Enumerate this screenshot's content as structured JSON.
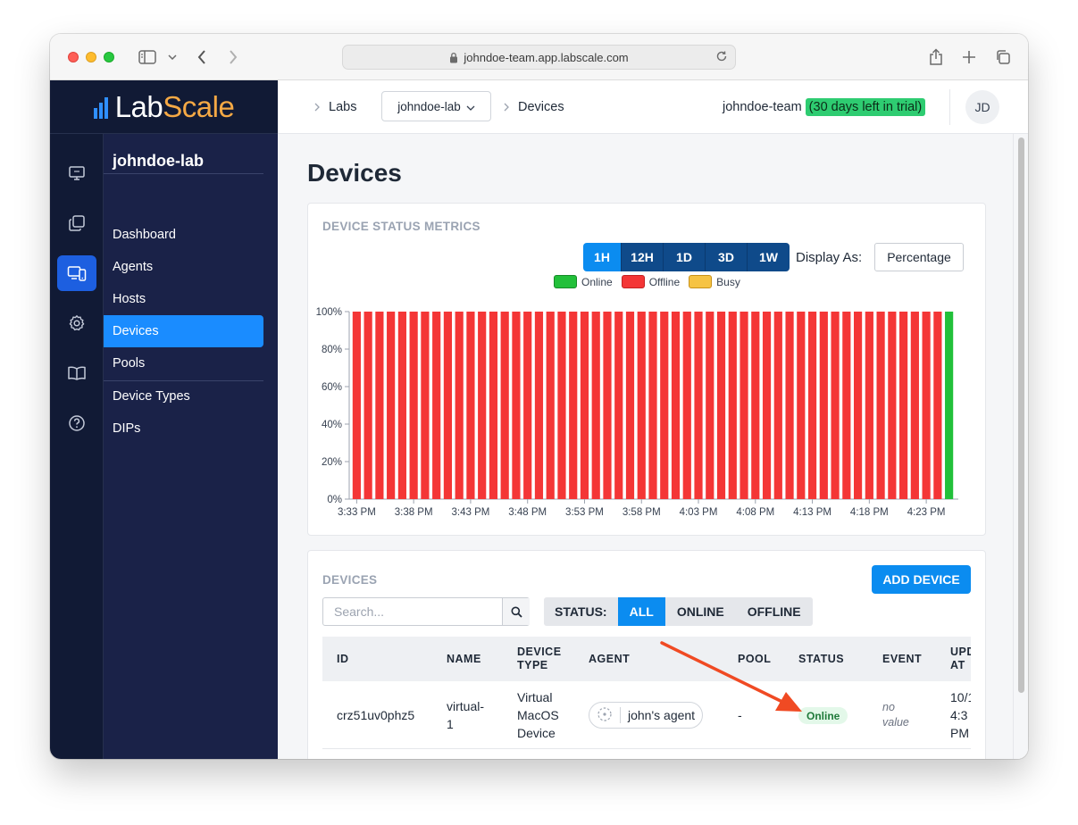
{
  "browser": {
    "url": "johndoe-team.app.labscale.com"
  },
  "brand": {
    "part1": "Lab",
    "part2": "Scale"
  },
  "rail": {
    "icons": [
      "monitor-icon",
      "copy-icon",
      "devices-icon",
      "gear-icon",
      "book-icon",
      "help-icon"
    ],
    "active": "devices-icon"
  },
  "sidebar": {
    "lab_name": "johndoe-lab",
    "items": [
      {
        "label": "Dashboard"
      },
      {
        "label": "Agents"
      },
      {
        "label": "Hosts"
      },
      {
        "label": "Devices"
      },
      {
        "label": "Pools"
      },
      {
        "label": "Device Types"
      },
      {
        "label": "DIPs"
      }
    ],
    "active_item": "Devices"
  },
  "topbar": {
    "breadcrumb_labs": "Labs",
    "lab_select": "johndoe-lab",
    "breadcrumb_devices": "Devices",
    "team": "johndoe-team",
    "trial": "(30 days left in trial)",
    "avatar": "JD"
  },
  "page": {
    "title": "Devices"
  },
  "metrics": {
    "label": "DEVICE STATUS METRICS",
    "ranges": [
      "1H",
      "12H",
      "1D",
      "3D",
      "1W"
    ],
    "active_range": "1H",
    "display_as_label": "Display As:",
    "display_as_value": "Percentage",
    "legend": [
      {
        "name": "Online",
        "color": "#22c03a",
        "border": "#168a28"
      },
      {
        "name": "Offline",
        "color": "#f43636",
        "border": "#c42222"
      },
      {
        "name": "Busy",
        "color": "#f6c343",
        "border": "#c8921a"
      }
    ]
  },
  "chart_data": {
    "type": "bar",
    "stacked": true,
    "y_tick_labels": [
      "0%",
      "20%",
      "40%",
      "60%",
      "80%",
      "100%"
    ],
    "ylim": [
      0,
      100
    ],
    "x_tick_labels": [
      "3:33 PM",
      "3:38 PM",
      "3:43 PM",
      "3:48 PM",
      "3:53 PM",
      "3:58 PM",
      "4:03 PM",
      "4:08 PM",
      "4:13 PM",
      "4:18 PM",
      "4:23 PM"
    ],
    "bar_count": 53,
    "series": [
      {
        "name": "Online",
        "color": "#22c03a",
        "values_note": "0 for first 52 bars, 100 for last bar"
      },
      {
        "name": "Offline",
        "color": "#f43636",
        "values_note": "100 for first 52 bars, 0 for last bar"
      },
      {
        "name": "Busy",
        "color": "#f6c343",
        "values_note": "0 for all bars"
      }
    ],
    "grid": false,
    "legend_position": "top-center"
  },
  "devices": {
    "label": "DEVICES",
    "add_button": "ADD DEVICE",
    "search_placeholder": "Search...",
    "status_label": "STATUS:",
    "status_options": [
      "ALL",
      "ONLINE",
      "OFFLINE"
    ],
    "active_status": "ALL",
    "columns": {
      "id": "ID",
      "name": "NAME",
      "type_1": "DEVICE",
      "type_2": "TYPE",
      "agent": "AGENT",
      "pool": "POOL",
      "status": "STATUS",
      "event": "EVENT",
      "upd_1": "UPD",
      "upd_2": "AT"
    },
    "rows": [
      {
        "id": "crz51uv0phz5",
        "name_1": "virtual-",
        "name_2": "1",
        "type_1": "Virtual",
        "type_2": "MacOS",
        "type_3": "Device",
        "agent": "john's agent",
        "pool": "-",
        "status": "Online",
        "event_1": "no",
        "event_2": "value",
        "upd_1": "10/1",
        "upd_2": "4:3",
        "upd_3": "PM"
      }
    ]
  },
  "annotation": {
    "arrow_color": "#f04a23"
  }
}
